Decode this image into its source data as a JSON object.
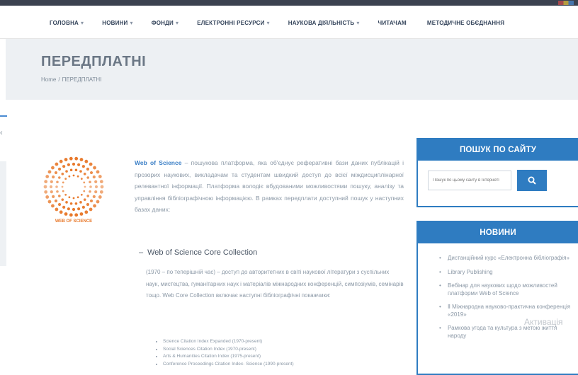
{
  "nav": {
    "items": [
      {
        "label": "ГОЛОВНА",
        "caret": "▾"
      },
      {
        "label": "НОВИНИ",
        "caret": "▾"
      },
      {
        "label": "ФОНДИ",
        "caret": "▾"
      },
      {
        "label": "ЕЛЕКТРОННІ РЕСУРСИ",
        "caret": "▾"
      },
      {
        "label": "НАУКОВА ДІЯЛЬНІСТЬ",
        "caret": "▾"
      },
      {
        "label": "ЧИТАЧАМ",
        "caret": ""
      },
      {
        "label": "МЕТОДИЧНЕ ОБЄДНАННЯ",
        "caret": ""
      }
    ]
  },
  "page": {
    "title": "ПЕРЕДПЛАТНІ",
    "breadcrumb": {
      "home": "Home",
      "separator": "/",
      "current": "ПЕРЕДПЛАТНІ"
    }
  },
  "logo": {
    "text": "WEB OF SCIENCE",
    "color": "#e8782a"
  },
  "article": {
    "link_text": "Web of Science",
    "intro_rest": " – пошукова платформа, яка об'єднує реферативні бази даних публікацій і прозорих наукових, викладачам та студентам швидкий доступ до всієї міждисциплінарної релевантної інформації. Платформа володіє вбудованими можливостями пошуку, аналізу та управління бібліографічною інформацією. В рамках передплати доступний пошук у наступних базах даних:",
    "section_title": "Web of Science Core Collection",
    "section_toggle": "–",
    "section_body": "(1970 – по теперішній час) – доступ до авторитетних в світі наукової літератури з суспільних наук, мистецтва, гуманітарних наук і матеріалів міжнародних конференцій, симпозіумів, семінарів тощо. Web Core Collection включає наступні бібліографічні покажчики:",
    "indexes": [
      "Science Citation Index Expanded (1970-present)",
      "Social Sciences Citation Index (1970-present)",
      "Arts & Humanities Citation Index (1975-present)",
      "Conference Proceedings Citation Index- Science (1990-present)"
    ]
  },
  "search_widget": {
    "title": "ПОШУК ПО САЙТУ",
    "placeholder": "Пошук по цьому сайту в Інтернеті"
  },
  "news_widget": {
    "title": "НОВИНИ",
    "items": [
      "Дистанційний курс «Електронна бібліографія»",
      "Library Publishing",
      "Вебінар для наукових щодо можливостей платформи Web of Science",
      "Ⅱ Міжнародна науково-практична конференція «2019»",
      "Рамкова угода та культура з метою життя народу"
    ]
  },
  "watermark": "Активація",
  "colors": {
    "accent": "#2f7cc1",
    "nav_text": "#33435a",
    "title_band": "#edf0f3"
  }
}
